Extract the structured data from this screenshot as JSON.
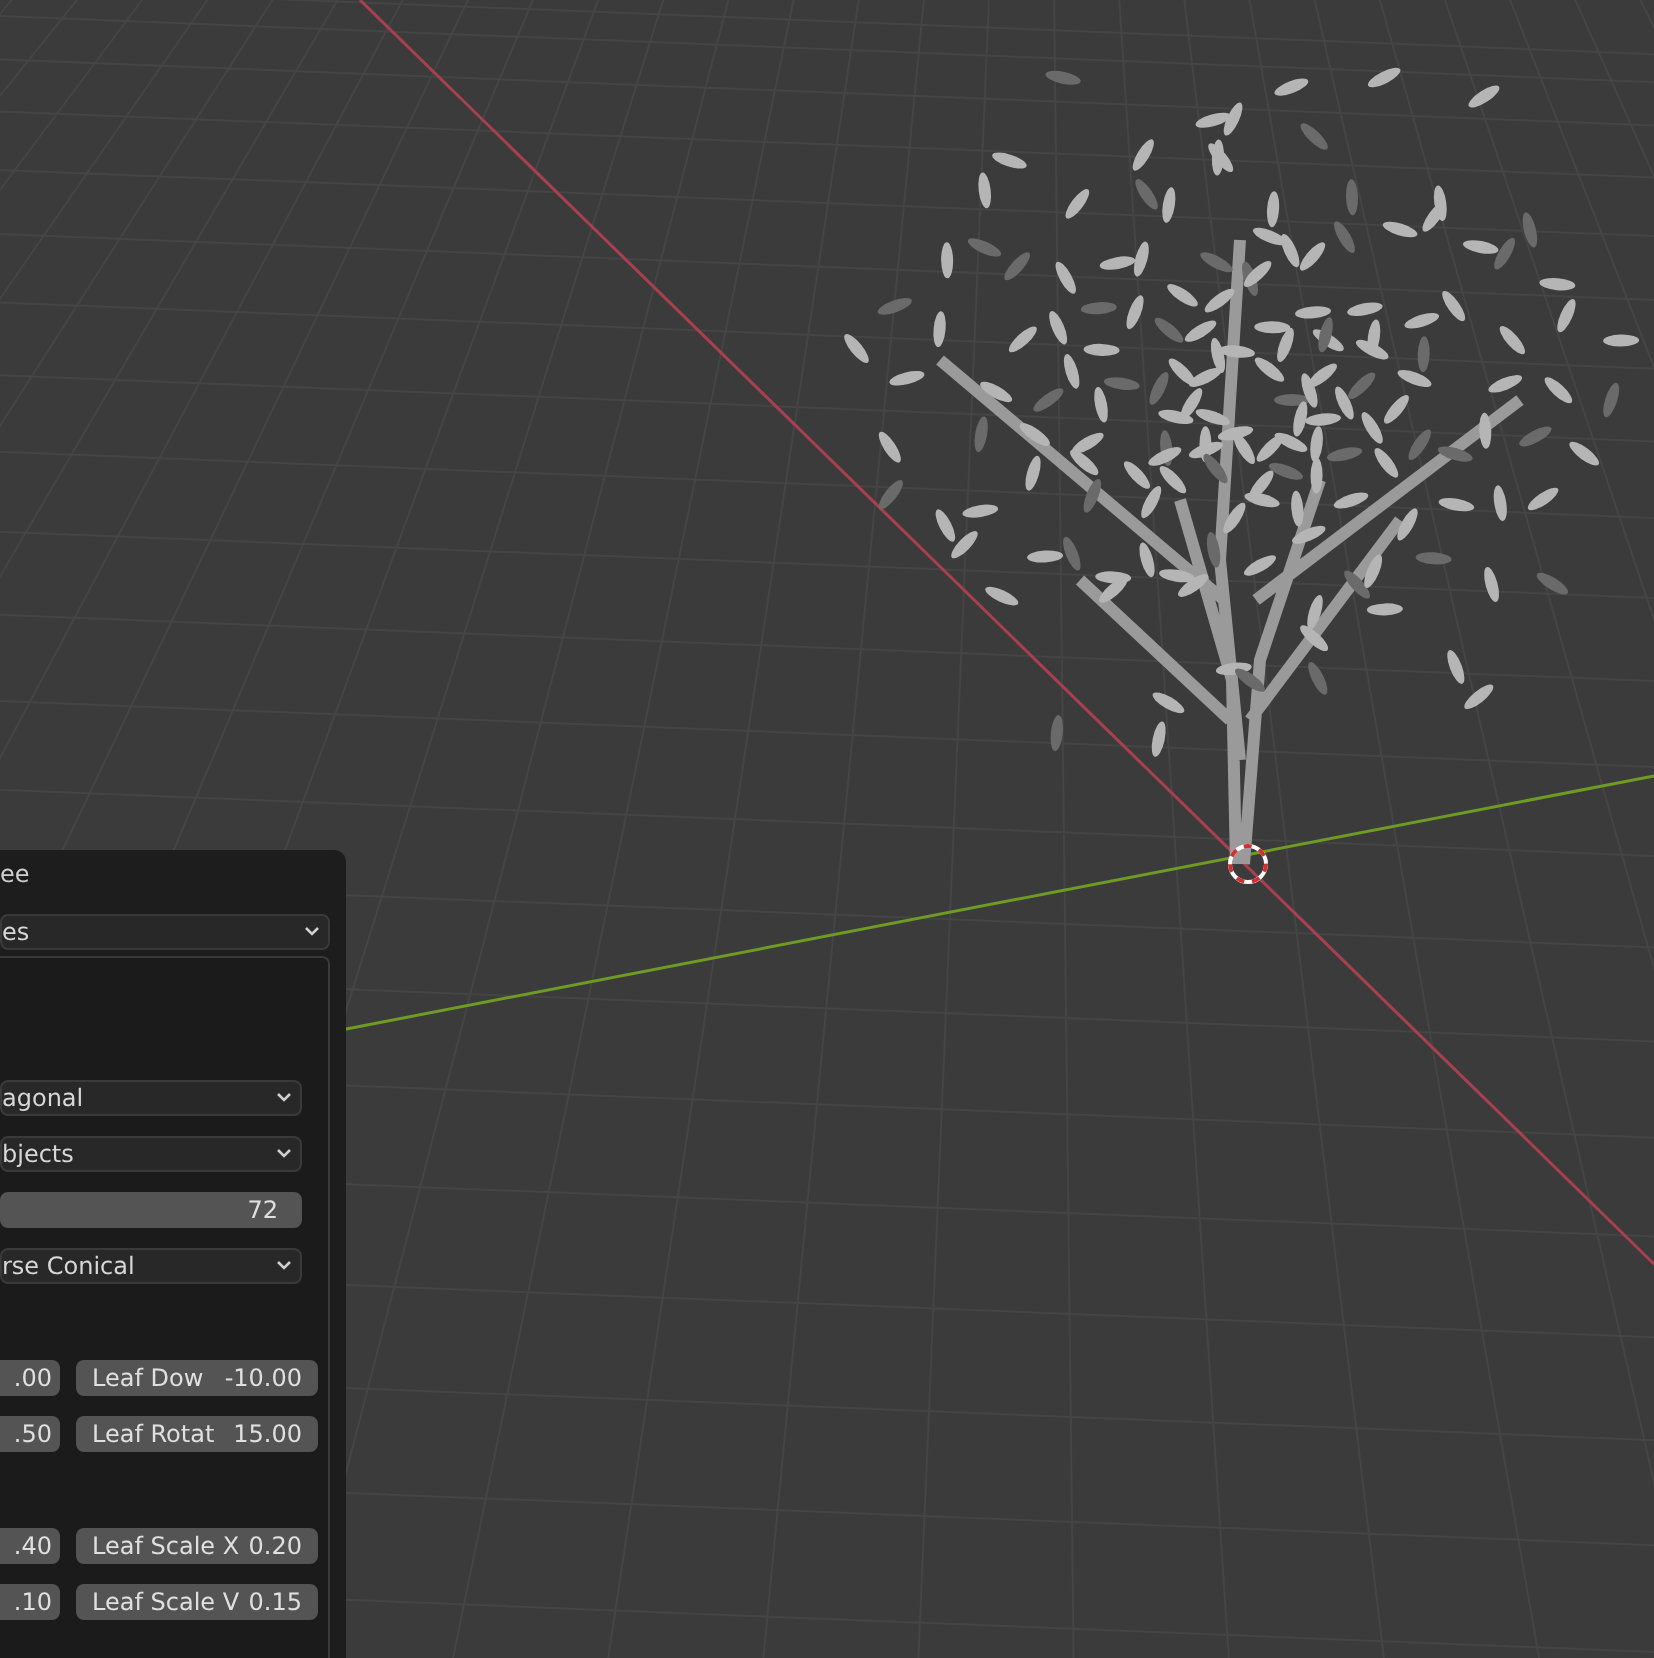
{
  "panel": {
    "title": "ee",
    "mode_dropdown": "es",
    "dropdowns": [
      {
        "kind": "select",
        "value": "agonal"
      },
      {
        "kind": "select",
        "value": "bjects"
      },
      {
        "kind": "number",
        "value": "72"
      },
      {
        "kind": "select",
        "value": "rse Conical"
      }
    ],
    "field_groups": [
      [
        {
          "left": ".00",
          "label": "Leaf Dow",
          "value": "-10.00"
        },
        {
          "left": ".50",
          "label": "Leaf Rotat",
          "value": "15.00"
        }
      ],
      [
        {
          "left": ".40",
          "label": "Leaf Scale X",
          "value": "0.20"
        },
        {
          "left": ".10",
          "label": "Leaf Scale V",
          "value": "0.15"
        }
      ]
    ]
  }
}
